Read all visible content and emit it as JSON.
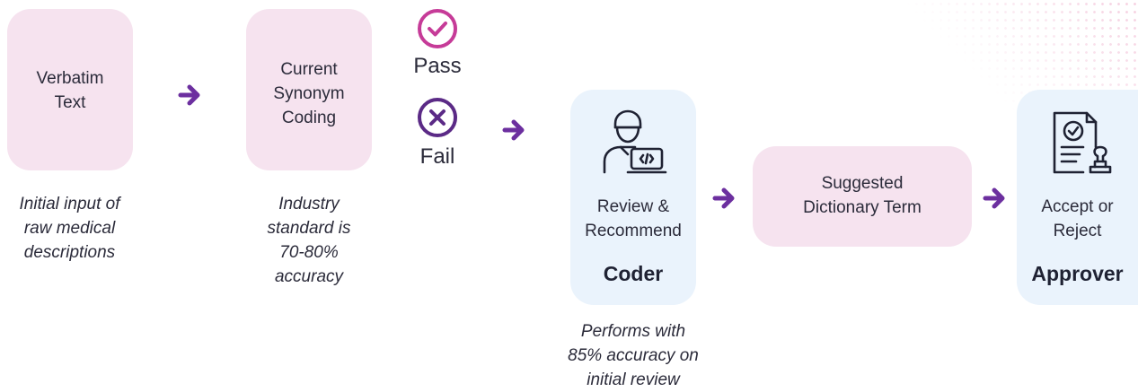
{
  "steps": {
    "verbatim": {
      "label": "Verbatim\nText",
      "caption": "Initial input of\nraw medical\ndescriptions"
    },
    "synonym": {
      "label": "Current\nSynonym\nCoding",
      "caption": "Industry\nstandard is\n70-80%\naccuracy"
    },
    "coder": {
      "label": "Review &\nRecommend",
      "role": "Coder",
      "caption": "Performs with\n85% accuracy on\ninitial review"
    },
    "suggested": {
      "label": "Suggested\nDictionary Term"
    },
    "approver": {
      "label": "Accept or\nReject",
      "role": "Approver"
    }
  },
  "outcomes": {
    "pass": {
      "label": "Pass",
      "icon": "check-circle-icon",
      "color": "#c63b98"
    },
    "fail": {
      "label": "Fail",
      "icon": "x-circle-icon",
      "color": "#5b2a86"
    }
  },
  "colors": {
    "pink_box": "#f6e3ef",
    "blue_box": "#eaf3fc",
    "arrow": "#6c2f9f",
    "text": "#2b2b3a"
  },
  "icons": [
    "arrow-right-icon",
    "coder-person-laptop-icon",
    "approval-document-stamp-icon"
  ]
}
